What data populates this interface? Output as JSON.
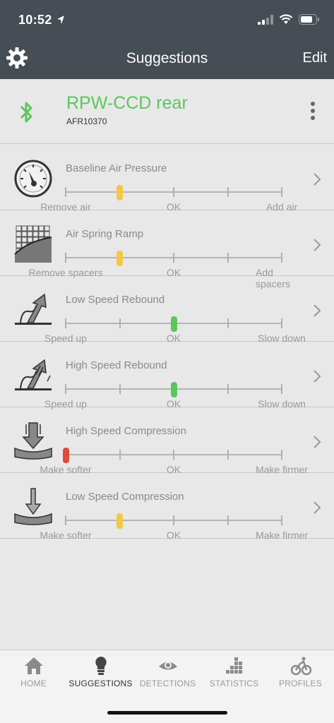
{
  "status_bar": {
    "time": "10:52"
  },
  "nav": {
    "title": "Suggestions",
    "edit_label": "Edit"
  },
  "device": {
    "name": "RPW-CCD rear",
    "id": "AFR10370",
    "name_color": "#5cc65c"
  },
  "suggestions": [
    {
      "label": "Baseline Air Pressure",
      "left": "Remove air",
      "mid": "OK",
      "right": "Add air",
      "position": 0.25,
      "color": "#f5c842",
      "icon": "pressure-gauge-icon"
    },
    {
      "label": "Air Spring Ramp",
      "left": "Remove spacers",
      "mid": "OK",
      "right": "Add spacers",
      "position": 0.25,
      "color": "#f5c842",
      "icon": "spring-ramp-icon"
    },
    {
      "label": "Low Speed Rebound",
      "left": "Speed up",
      "mid": "OK",
      "right": "Slow down",
      "position": 0.5,
      "color": "#5cc65c",
      "icon": "low-speed-rebound-icon"
    },
    {
      "label": "High Speed Rebound",
      "left": "Speed up",
      "mid": "OK",
      "right": "Slow down",
      "position": 0.5,
      "color": "#5cc65c",
      "icon": "high-speed-rebound-icon"
    },
    {
      "label": "High Speed Compression",
      "left": "Make softer",
      "mid": "OK",
      "right": "Make firmer",
      "position": 0.0,
      "color": "#e04a3a",
      "icon": "high-speed-compression-icon"
    },
    {
      "label": "Low Speed Compression",
      "left": "Make softer",
      "mid": "OK",
      "right": "Make firmer",
      "position": 0.25,
      "color": "#f5c842",
      "icon": "low-speed-compression-icon"
    }
  ],
  "tabs": [
    {
      "label": "HOME",
      "icon": "home-icon"
    },
    {
      "label": "SUGGESTIONS",
      "icon": "lightbulb-icon",
      "active": true
    },
    {
      "label": "DETECTIONS",
      "icon": "eye-icon"
    },
    {
      "label": "STATISTICS",
      "icon": "bar-blocks-icon"
    },
    {
      "label": "PROFILES",
      "icon": "cyclist-icon"
    }
  ]
}
